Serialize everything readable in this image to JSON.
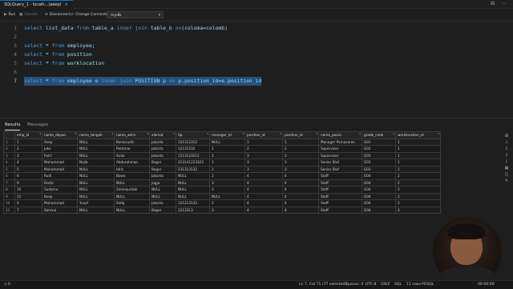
{
  "window": {
    "tab_title": "SQLQuery_1 - localh...(aeep)",
    "tab_close": "×",
    "controls": [
      "⊟",
      "⋯"
    ]
  },
  "toolbar": {
    "run": "Run",
    "cancel": "Cancel",
    "disconnect": "Disconnect",
    "change_connection": "Change Connection",
    "database": "mydb"
  },
  "editor": {
    "lines": [
      {
        "n": "1",
        "parts": [
          [
            "kw",
            "select "
          ],
          [
            "id",
            "list_data "
          ],
          [
            "kw",
            "from "
          ],
          [
            "id",
            "table_a "
          ],
          [
            "kw",
            "inner join "
          ],
          [
            "id",
            "table_b "
          ],
          [
            "kw",
            "on"
          ],
          [
            "id",
            "(coloma=colomb)"
          ]
        ]
      },
      {
        "n": "2",
        "parts": []
      },
      {
        "n": "3",
        "parts": [
          [
            "kw",
            "select "
          ],
          [
            "id",
            "* "
          ],
          [
            "kw",
            "from "
          ],
          [
            "id",
            "employee;"
          ]
        ]
      },
      {
        "n": "4",
        "parts": [
          [
            "kw",
            "select "
          ],
          [
            "id",
            "* "
          ],
          [
            "kw",
            "from "
          ],
          [
            "id",
            "position"
          ]
        ]
      },
      {
        "n": "5",
        "parts": [
          [
            "kw",
            "select "
          ],
          [
            "id",
            "* "
          ],
          [
            "kw",
            "from "
          ],
          [
            "id",
            "worklocation"
          ]
        ]
      },
      {
        "n": "6",
        "parts": []
      },
      {
        "n": "7",
        "selected": true,
        "parts": [
          [
            "kw",
            "select "
          ],
          [
            "id",
            "* "
          ],
          [
            "kw",
            "from "
          ],
          [
            "id",
            "employee e "
          ],
          [
            "kw",
            "inner join "
          ],
          [
            "id",
            "POSITION p "
          ],
          [
            "kw",
            "on "
          ],
          [
            "id",
            "p.position_id=e.position_id"
          ]
        ]
      }
    ]
  },
  "panel": {
    "tabs": [
      "Results",
      "Messages"
    ]
  },
  "results": {
    "columns": [
      "emp_id",
      "nama_depan",
      "nama_tengah",
      "nama_akhir",
      "alamat",
      "tlp",
      "manager_id",
      "position_id",
      "position_id",
      "nama_posisi",
      "grade_code",
      "worklocation_id"
    ],
    "rows": [
      [
        "1",
        "1",
        "Asep",
        "NULL",
        "Komarudin",
        "Jakarta",
        "121312312",
        "NULL",
        "1",
        "1",
        "Manager Pemasaran",
        "G01",
        "1"
      ],
      [
        "2",
        "2",
        "Joko",
        "NULL",
        "Partomo",
        "Jakarta",
        "12131232",
        "1",
        "2",
        "2",
        "Supervisor",
        "G02",
        "1"
      ],
      [
        "3",
        "3",
        "Putri",
        "NULL",
        "Aulia",
        "Jakarta",
        "1213123212",
        "2",
        "3",
        "3",
        "Supervisor",
        "G03",
        "1"
      ],
      [
        "4",
        "4",
        "Muhammad",
        "Najib",
        "Abdurahman",
        "Bogor",
        "213141223323",
        "1",
        "3",
        "3",
        "Senior Staf",
        "G03",
        "1"
      ],
      [
        "5",
        "5",
        "Muhammad",
        "NULL",
        "Idris",
        "Bogor",
        "231313132",
        "1",
        "3",
        "3",
        "Senior Staf",
        "G03",
        "1"
      ],
      [
        "6",
        "6",
        "Rudi",
        "NULL",
        "Bowo",
        "Jakarta",
        "NULL",
        "2",
        "4",
        "4",
        "Staff",
        "G04",
        "2"
      ],
      [
        "7",
        "9",
        "Darto",
        "NULL",
        "NULL",
        "Jogja",
        "NULL",
        "3",
        "4",
        "4",
        "Staff",
        "G04",
        "2"
      ],
      [
        "8",
        "10",
        "Sudarno",
        "NULL",
        "Simanjuntak",
        "NULL",
        "NULL",
        "3",
        "4",
        "4",
        "Staff",
        "G04",
        "2"
      ],
      [
        "9",
        "11",
        "Koep",
        "NULL",
        "NULL",
        "NULL",
        "NULL",
        "NULL",
        "4",
        "4",
        "Staff",
        "G04",
        "2"
      ],
      [
        "10",
        "4",
        "Muhammad",
        "Yusuf",
        "Sidiq",
        "Jakarta",
        "121213132",
        "2",
        "4",
        "4",
        "Staff",
        "G04",
        "2"
      ],
      [
        "11",
        "7",
        "Samsul",
        "NULL",
        "NULL",
        "Bogor",
        "1213313",
        "3",
        "4",
        "4",
        "Staff",
        "G04",
        "2"
      ]
    ]
  },
  "side_icons": [
    "⊞",
    "⇩",
    "⇩",
    "⇩",
    "⇩",
    "▦",
    "◫",
    "✎"
  ],
  "statusbar": {
    "left": "◇ 0",
    "position": "Ln 7, Col 71 (77 selected)",
    "spaces": "Spaces: 4",
    "encoding": "UTF-8",
    "eol": "CRLF",
    "language": "SQL",
    "rows": "11 rows",
    "dialect": "PGSQL",
    "time": "00:00:00"
  }
}
